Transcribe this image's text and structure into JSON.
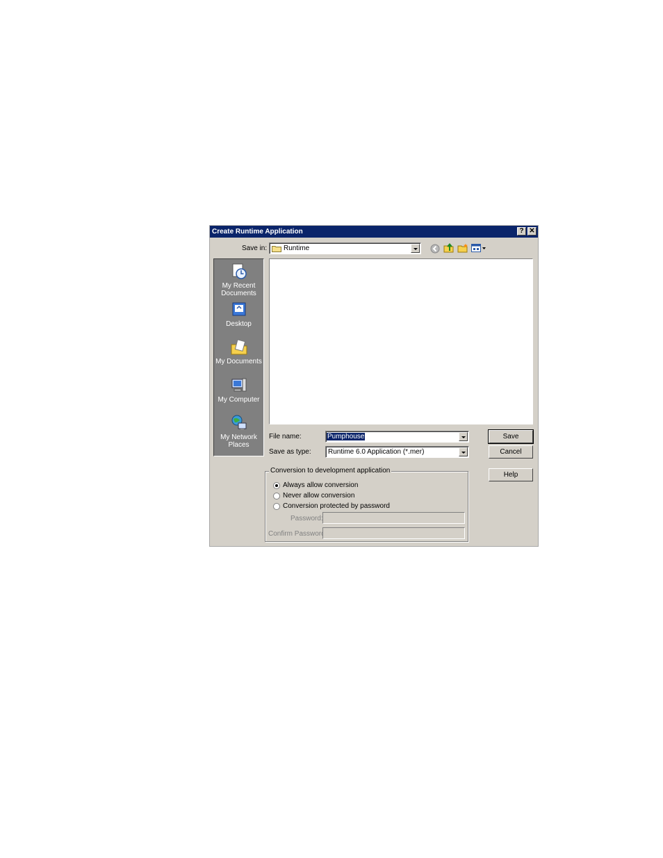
{
  "dialog": {
    "title": "Create Runtime Application",
    "help_glyph": "?",
    "close_glyph": "✕"
  },
  "save_in": {
    "label": "Save in:",
    "value": "Runtime"
  },
  "toolbar_icons": [
    "back-icon",
    "up-folder-icon",
    "new-folder-icon",
    "views-menu-icon"
  ],
  "places": [
    {
      "label_line1": "My Recent",
      "label_line2": "Documents",
      "icon": "recent-documents-icon"
    },
    {
      "label_line1": "Desktop",
      "label_line2": "",
      "icon": "desktop-icon"
    },
    {
      "label_line1": "My Documents",
      "label_line2": "",
      "icon": "my-documents-icon"
    },
    {
      "label_line1": "My Computer",
      "label_line2": "",
      "icon": "my-computer-icon"
    },
    {
      "label_line1": "My Network",
      "label_line2": "Places",
      "icon": "network-places-icon"
    }
  ],
  "file_name": {
    "label": "File name:",
    "value": "Pumphouse"
  },
  "save_as_type": {
    "label": "Save as type:",
    "value": "Runtime 6.0 Application (*.mer)"
  },
  "buttons": {
    "save": "Save",
    "cancel": "Cancel",
    "help": "Help"
  },
  "conversion": {
    "title": "Conversion to development application",
    "options": [
      {
        "label": "Always allow conversion",
        "selected": true
      },
      {
        "label": "Never allow conversion",
        "selected": false
      },
      {
        "label": "Conversion protected by password",
        "selected": false
      }
    ],
    "password_label": "Password:",
    "confirm_password_label": "Confirm Password:"
  }
}
